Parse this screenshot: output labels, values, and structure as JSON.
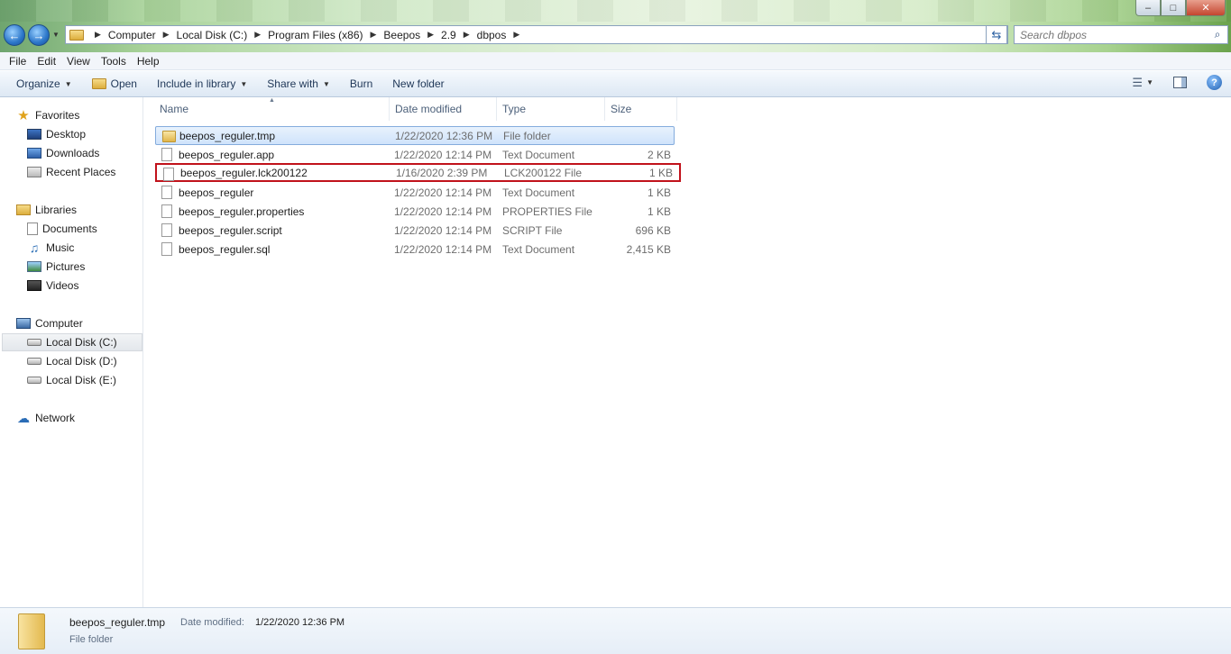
{
  "window": {
    "minimize_glyph": "–",
    "maximize_glyph": "□",
    "close_glyph": "✕"
  },
  "nav": {
    "back_glyph": "←",
    "forward_glyph": "→",
    "dropdown_glyph": "▼"
  },
  "address": {
    "breadcrumbs": [
      "Computer",
      "Local Disk (C:)",
      "Program Files (x86)",
      "Beepos",
      "2.9",
      "dbpos"
    ],
    "separator": "▶",
    "dropdown_glyph": "▼",
    "refresh_glyph": "⇆"
  },
  "search": {
    "placeholder": "Search dbpos",
    "icon": "⌕"
  },
  "menubar": {
    "items": [
      "File",
      "Edit",
      "View",
      "Tools",
      "Help"
    ]
  },
  "toolbar": {
    "organize": "Organize",
    "open": "Open",
    "include_in_library": "Include in library",
    "share_with": "Share with",
    "burn": "Burn",
    "new_folder": "New folder",
    "caret": "▼",
    "views_glyph": "☰",
    "help_glyph": "?"
  },
  "navpane": {
    "favorites": "Favorites",
    "desktop": "Desktop",
    "downloads": "Downloads",
    "recent_places": "Recent Places",
    "libraries": "Libraries",
    "documents": "Documents",
    "music": "Music",
    "pictures": "Pictures",
    "videos": "Videos",
    "computer": "Computer",
    "disk_c": "Local Disk (C:)",
    "disk_d": "Local Disk (D:)",
    "disk_e": "Local Disk (E:)",
    "network": "Network",
    "star_glyph": "★",
    "music_glyph": "♫",
    "network_glyph": "☁"
  },
  "columns": {
    "name": "Name",
    "date": "Date modified",
    "type": "Type",
    "size": "Size",
    "sort_glyph": "▲"
  },
  "files": [
    {
      "name": "beepos_reguler.tmp",
      "date": "1/22/2020 12:36 PM",
      "type": "File folder",
      "size": ""
    },
    {
      "name": "beepos_reguler.app",
      "date": "1/22/2020 12:14 PM",
      "type": "Text Document",
      "size": "2 KB"
    },
    {
      "name": "beepos_reguler.lck200122",
      "date": "1/16/2020 2:39 PM",
      "type": "LCK200122 File",
      "size": "1 KB"
    },
    {
      "name": "beepos_reguler",
      "date": "1/22/2020 12:14 PM",
      "type": "Text Document",
      "size": "1 KB"
    },
    {
      "name": "beepos_reguler.properties",
      "date": "1/22/2020 12:14 PM",
      "type": "PROPERTIES File",
      "size": "1 KB"
    },
    {
      "name": "beepos_reguler.script",
      "date": "1/22/2020 12:14 PM",
      "type": "SCRIPT File",
      "size": "696 KB"
    },
    {
      "name": "beepos_reguler.sql",
      "date": "1/22/2020 12:14 PM",
      "type": "Text Document",
      "size": "2,415 KB"
    }
  ],
  "details": {
    "name": "beepos_reguler.tmp",
    "modified_label": "Date modified:",
    "modified_value": "1/22/2020 12:36 PM",
    "type": "File folder"
  }
}
